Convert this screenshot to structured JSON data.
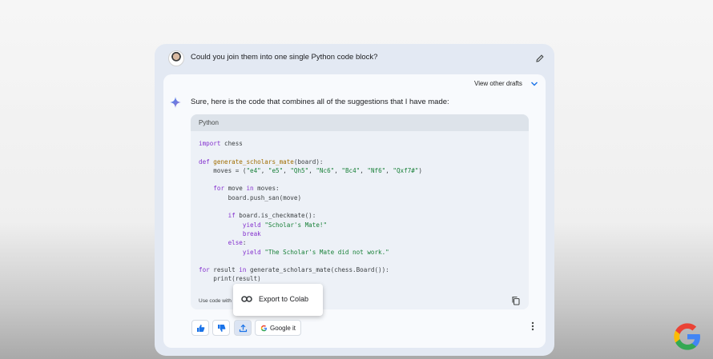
{
  "prompt": {
    "text": "Could you join them into one single Python code block?",
    "avatar_icon": "user-avatar",
    "edit_icon": "pencil-icon"
  },
  "response": {
    "drafts_label": "View other drafts",
    "drafts_icon": "chevron-down-icon",
    "assistant_icon": "sparkle-icon",
    "intro_text": "Sure, here is the code that combines all of the suggestions that I have made:",
    "code": {
      "language": "Python",
      "lines": [
        "import chess",
        "",
        "def generate_scholars_mate(board):",
        "    moves = (\"e4\", \"e5\", \"Qh5\", \"Nc6\", \"Bc4\", \"Nf6\", \"Qxf7#\")",
        "",
        "    for move in moves:",
        "        board.push_san(move)",
        "",
        "        if board.is_checkmate():",
        "            yield \"Scholar's Mate!\"",
        "            break",
        "        else:",
        "            yield \"The Scholar's Mate did not work.\"",
        "",
        "for result in generate_scholars_mate(chess.Board()):",
        "    print(result)"
      ],
      "footer_text": "Use code with",
      "copy_icon": "copy-icon"
    },
    "export_menu": {
      "icon": "colab-icon",
      "label": "Export to Colab"
    },
    "actions": {
      "thumbs_up_icon": "thumbs-up-icon",
      "thumbs_down_icon": "thumbs-down-icon",
      "share_icon": "share-icon",
      "google_it_label": "Google it",
      "more_icon": "more-vert-icon"
    }
  },
  "colors": {
    "accent": "#1a73e8",
    "keyword": "#8430ce",
    "function": "#a06d00",
    "string": "#188038"
  }
}
